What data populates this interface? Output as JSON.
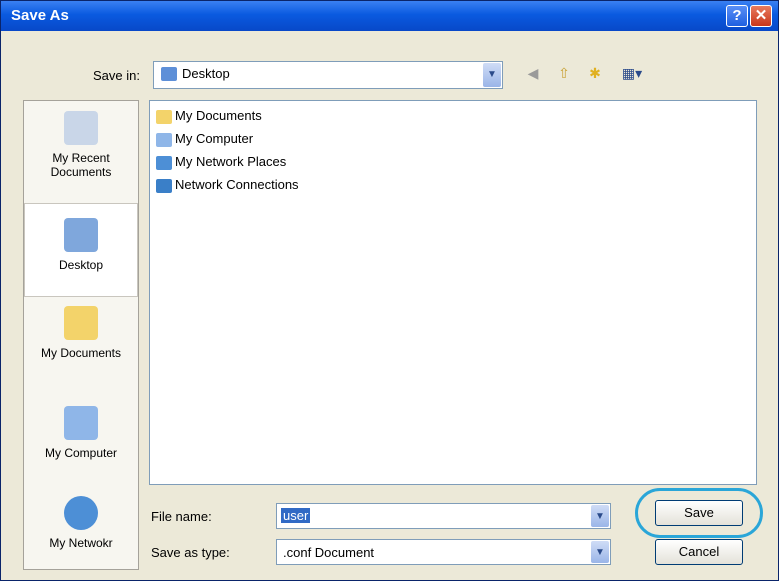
{
  "window": {
    "title": "Save As",
    "help_label": "?",
    "close_label": "✕"
  },
  "toolbar": {
    "save_in_label": "Save in:",
    "save_in_value": "Desktop",
    "back_icon": "back-icon",
    "up_icon": "up-folder-icon",
    "new_folder_icon": "new-folder-icon",
    "views_icon": "views-menu-icon"
  },
  "places": [
    {
      "label": "My Recent Documents",
      "icon": "recent-documents-icon"
    },
    {
      "label": "Desktop",
      "icon": "desktop-icon"
    },
    {
      "label": "My Documents",
      "icon": "my-documents-icon"
    },
    {
      "label": "My Computer",
      "icon": "my-computer-icon"
    },
    {
      "label": "My Netwokr",
      "icon": "my-network-icon"
    }
  ],
  "files": [
    {
      "name": "My Documents",
      "icon": "folder-icon"
    },
    {
      "name": "My Computer",
      "icon": "computer-icon"
    },
    {
      "name": "My Network Places",
      "icon": "network-places-icon"
    },
    {
      "name": "Network Connections",
      "icon": "network-connections-icon"
    }
  ],
  "form": {
    "file_name_label": "File name:",
    "file_name_value": "user",
    "save_as_type_label": "Save as type:",
    "save_as_type_value": ".conf Document"
  },
  "buttons": {
    "save": "Save",
    "cancel": "Cancel"
  },
  "colors": {
    "title_bar": "#0a5ae0",
    "highlight_ring": "#2aa6d8",
    "selection": "#316ac5"
  }
}
